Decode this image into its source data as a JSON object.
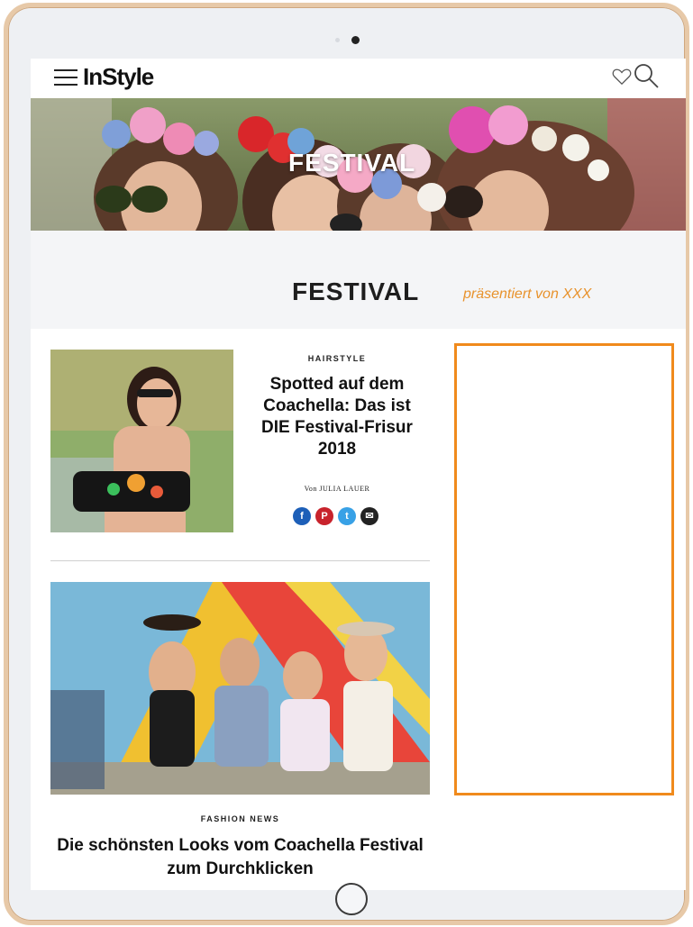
{
  "header": {
    "logo": "InStyle"
  },
  "hero": {
    "overlay_text": "FESTIVAL"
  },
  "section": {
    "title": "FESTIVAL",
    "presented_by": "präsentiert von XXX"
  },
  "articles": [
    {
      "category": "HAIRSTYLE",
      "title": "Spotted auf dem Coachella: Das ist DIE Festival-Frisur 2018",
      "author": "Von JULIA LAUER",
      "share": [
        {
          "icon": "facebook-icon",
          "glyph": "f",
          "color": "#1d5fb8"
        },
        {
          "icon": "pinterest-icon",
          "glyph": "P",
          "color": "#c8232c"
        },
        {
          "icon": "twitter-icon",
          "glyph": "t",
          "color": "#38a1e6"
        },
        {
          "icon": "email-icon",
          "glyph": "✉",
          "color": "#222222"
        }
      ]
    },
    {
      "category": "FASHION NEWS",
      "title": "Die schönsten Looks vom Coachella Festival zum Durchklicken"
    }
  ],
  "colors": {
    "accent": "#f08a1c",
    "presented_text": "#e8922c",
    "frame": "#e7c9a8"
  }
}
